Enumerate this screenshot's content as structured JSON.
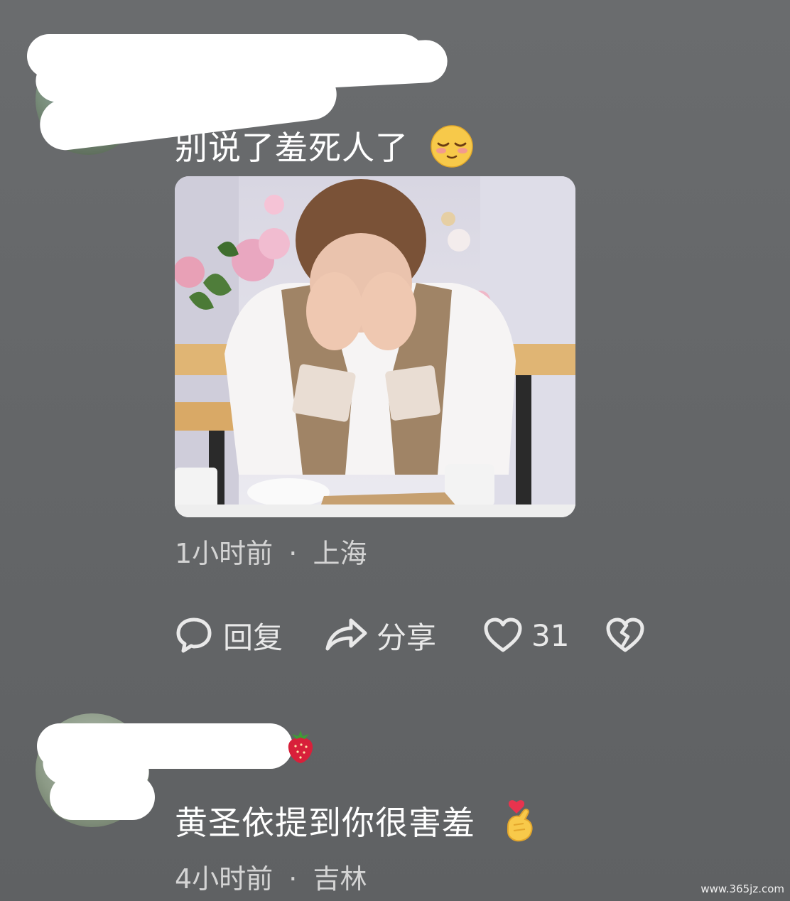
{
  "comments": [
    {
      "text": "别说了羞死人了",
      "emoji": "shy-face-emoji",
      "time": "1小时前",
      "separator": "·",
      "location": "上海",
      "actions": {
        "reply_label": "回复",
        "share_label": "分享",
        "like_count": "31"
      }
    },
    {
      "username_badge": "strawberry-emoji",
      "text": "黄圣依提到你很害羞",
      "emoji": "finger-heart-emoji",
      "time": "4小时前",
      "separator": "·",
      "location": "吉林"
    }
  ],
  "watermark": "www.365jz.com",
  "colors": {
    "background": "#656769",
    "text_primary": "#ffffff",
    "text_secondary": "#d4d4d4"
  }
}
